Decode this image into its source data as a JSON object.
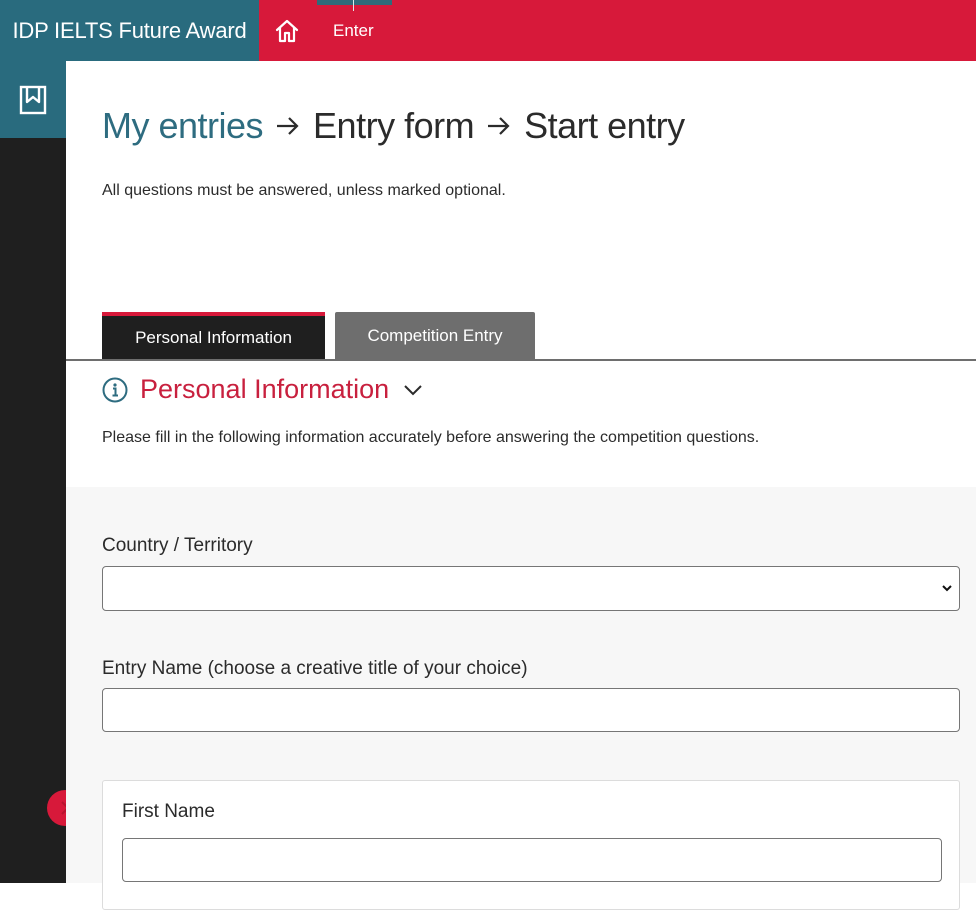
{
  "app": {
    "title": "IDP IELTS Future Award"
  },
  "nav": {
    "enter_label": "Enter"
  },
  "breadcrumb": {
    "items": [
      "My entries",
      "Entry form",
      "Start entry"
    ]
  },
  "intro_text": "All questions must be answered, unless marked optional.",
  "tabs": [
    {
      "label": "Personal Information",
      "active": true
    },
    {
      "label": "Competition Entry",
      "active": false
    }
  ],
  "section": {
    "title": "Personal Information",
    "description": "Please fill in the following information accurately before answering the competition questions."
  },
  "form": {
    "country_label": "Country / Territory",
    "country_value": "",
    "entry_name_label": "Entry Name (choose a creative title of your choice)",
    "entry_name_value": "",
    "first_name_label": "First Name",
    "first_name_value": ""
  },
  "colors": {
    "brand_red": "#d7193a",
    "brand_teal": "#296b7e",
    "sidebar_dark": "#1f1f1f",
    "tab_inactive": "#6e6e6e",
    "section_title_red": "#c8203e"
  },
  "icons": {
    "home": "home-icon",
    "bookmark": "bookmark-icon",
    "arrow": "arrow-right-icon",
    "info": "info-icon",
    "chevron": "chevron-down-icon",
    "expand": "chevron-right-icon"
  }
}
